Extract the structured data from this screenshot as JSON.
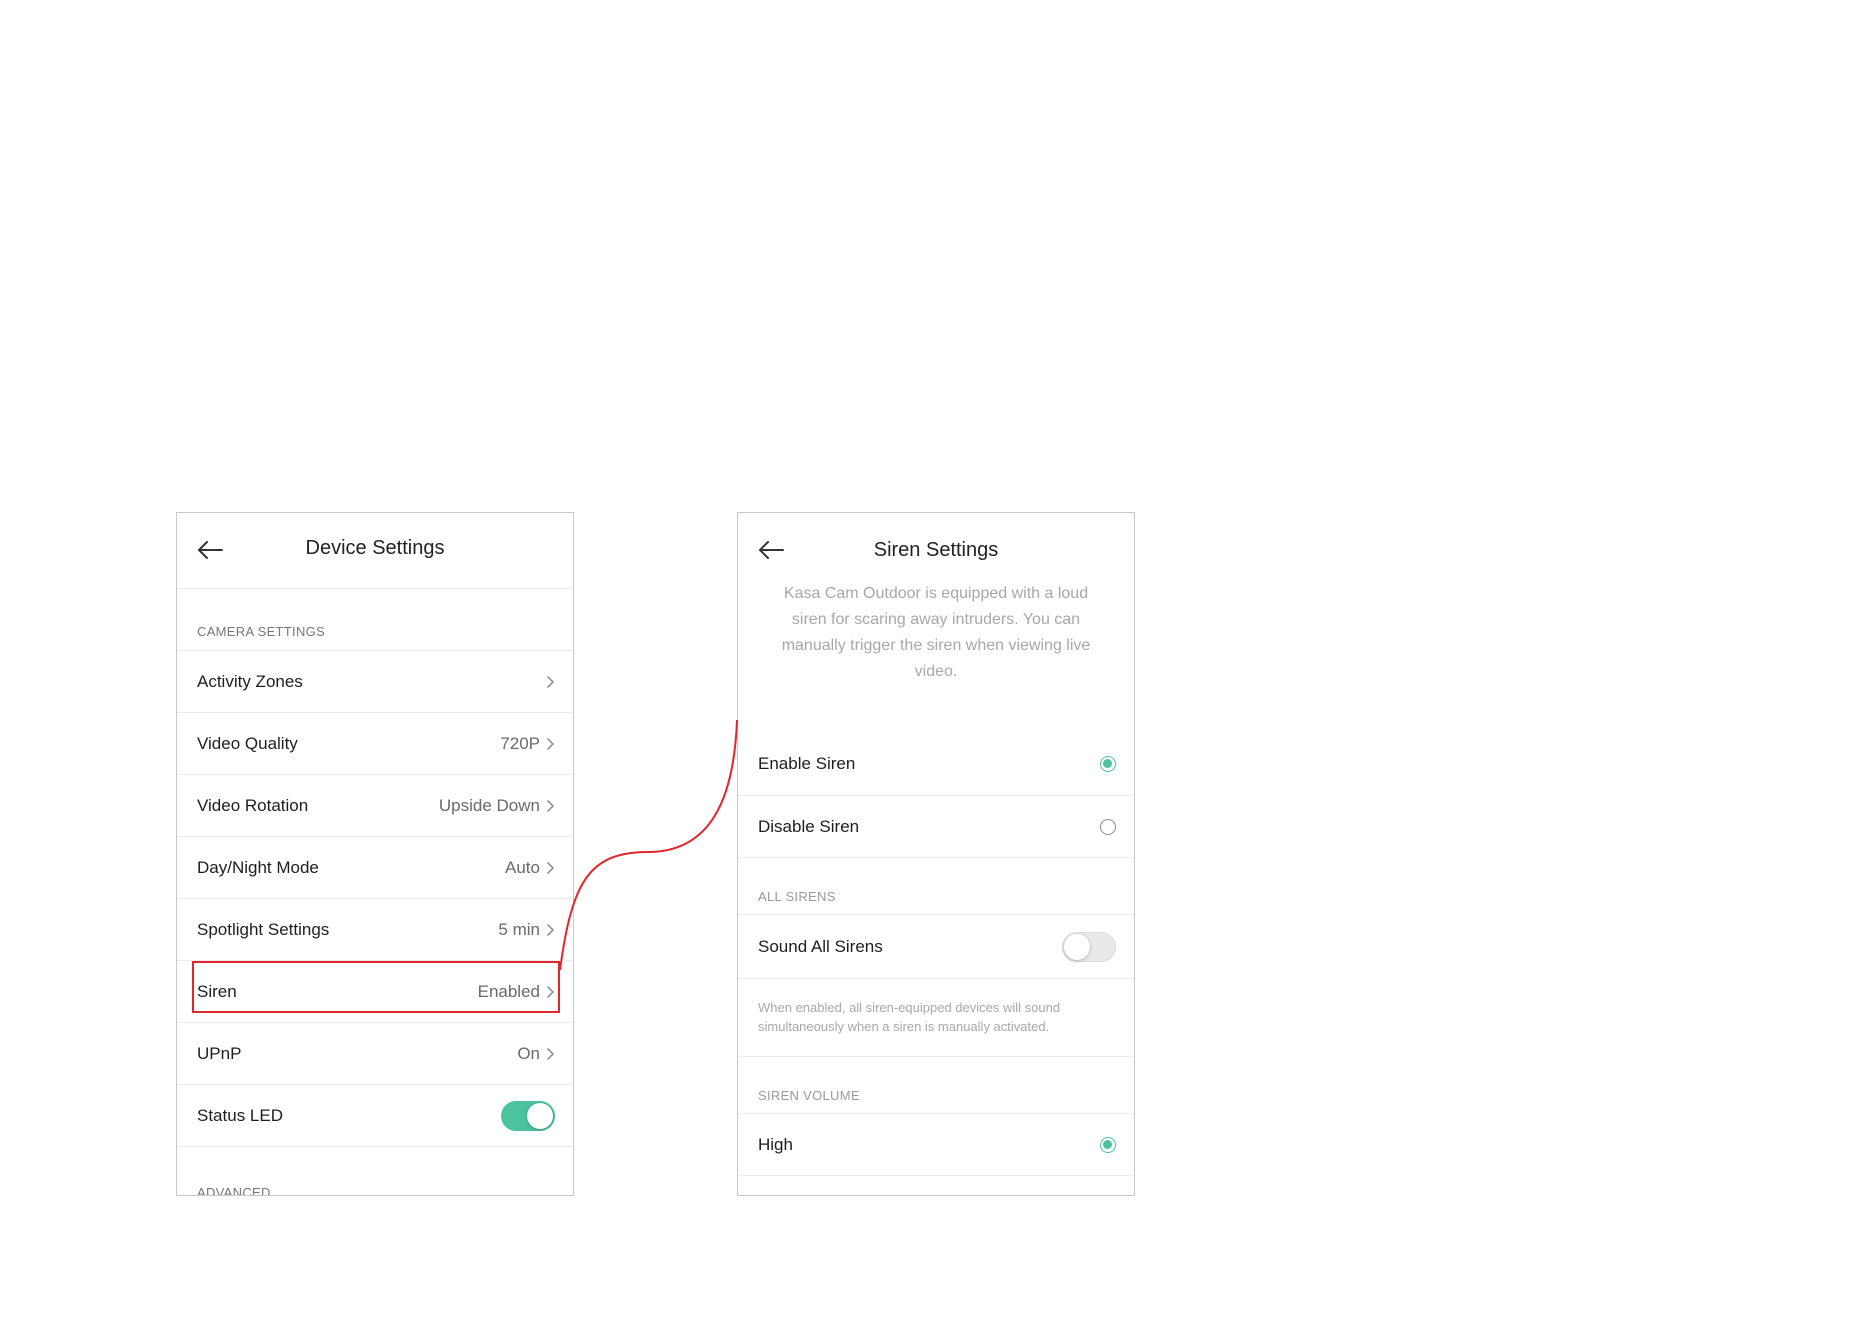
{
  "device_settings": {
    "title": "Device Settings",
    "section_camera": "CAMERA SETTINGS",
    "rows": [
      {
        "label": "Activity Zones",
        "value": ""
      },
      {
        "label": "Video Quality",
        "value": "720P"
      },
      {
        "label": "Video Rotation",
        "value": "Upside Down"
      },
      {
        "label": "Day/Night Mode",
        "value": "Auto"
      },
      {
        "label": "Spotlight Settings",
        "value": "5 min"
      },
      {
        "label": "Siren",
        "value": "Enabled"
      },
      {
        "label": "UPnP",
        "value": "On"
      },
      {
        "label": "Status LED",
        "value": ""
      }
    ],
    "status_led_on": true,
    "section_advanced": "ADVANCED"
  },
  "siren_settings": {
    "title": "Siren Settings",
    "description": "Kasa Cam Outdoor is equipped with a loud siren for scaring away intruders. You can manually trigger the siren when viewing live video.",
    "enable_label": "Enable Siren",
    "disable_label": "Disable Siren",
    "selected": "enable",
    "section_all_sirens": "ALL SIRENS",
    "sound_all_label": "Sound All Sirens",
    "sound_all_on": false,
    "sound_all_note": "When enabled, all siren-equipped devices will sound simultaneously when a siren is manually activated.",
    "section_volume": "SIREN VOLUME",
    "volume_high_label": "High",
    "volume_selected": "high"
  },
  "colors": {
    "accent": "#4cc29e",
    "highlight": "#e0262a"
  },
  "icons": {
    "back": "arrow-left-icon",
    "chevron": "chevron-right-icon"
  }
}
